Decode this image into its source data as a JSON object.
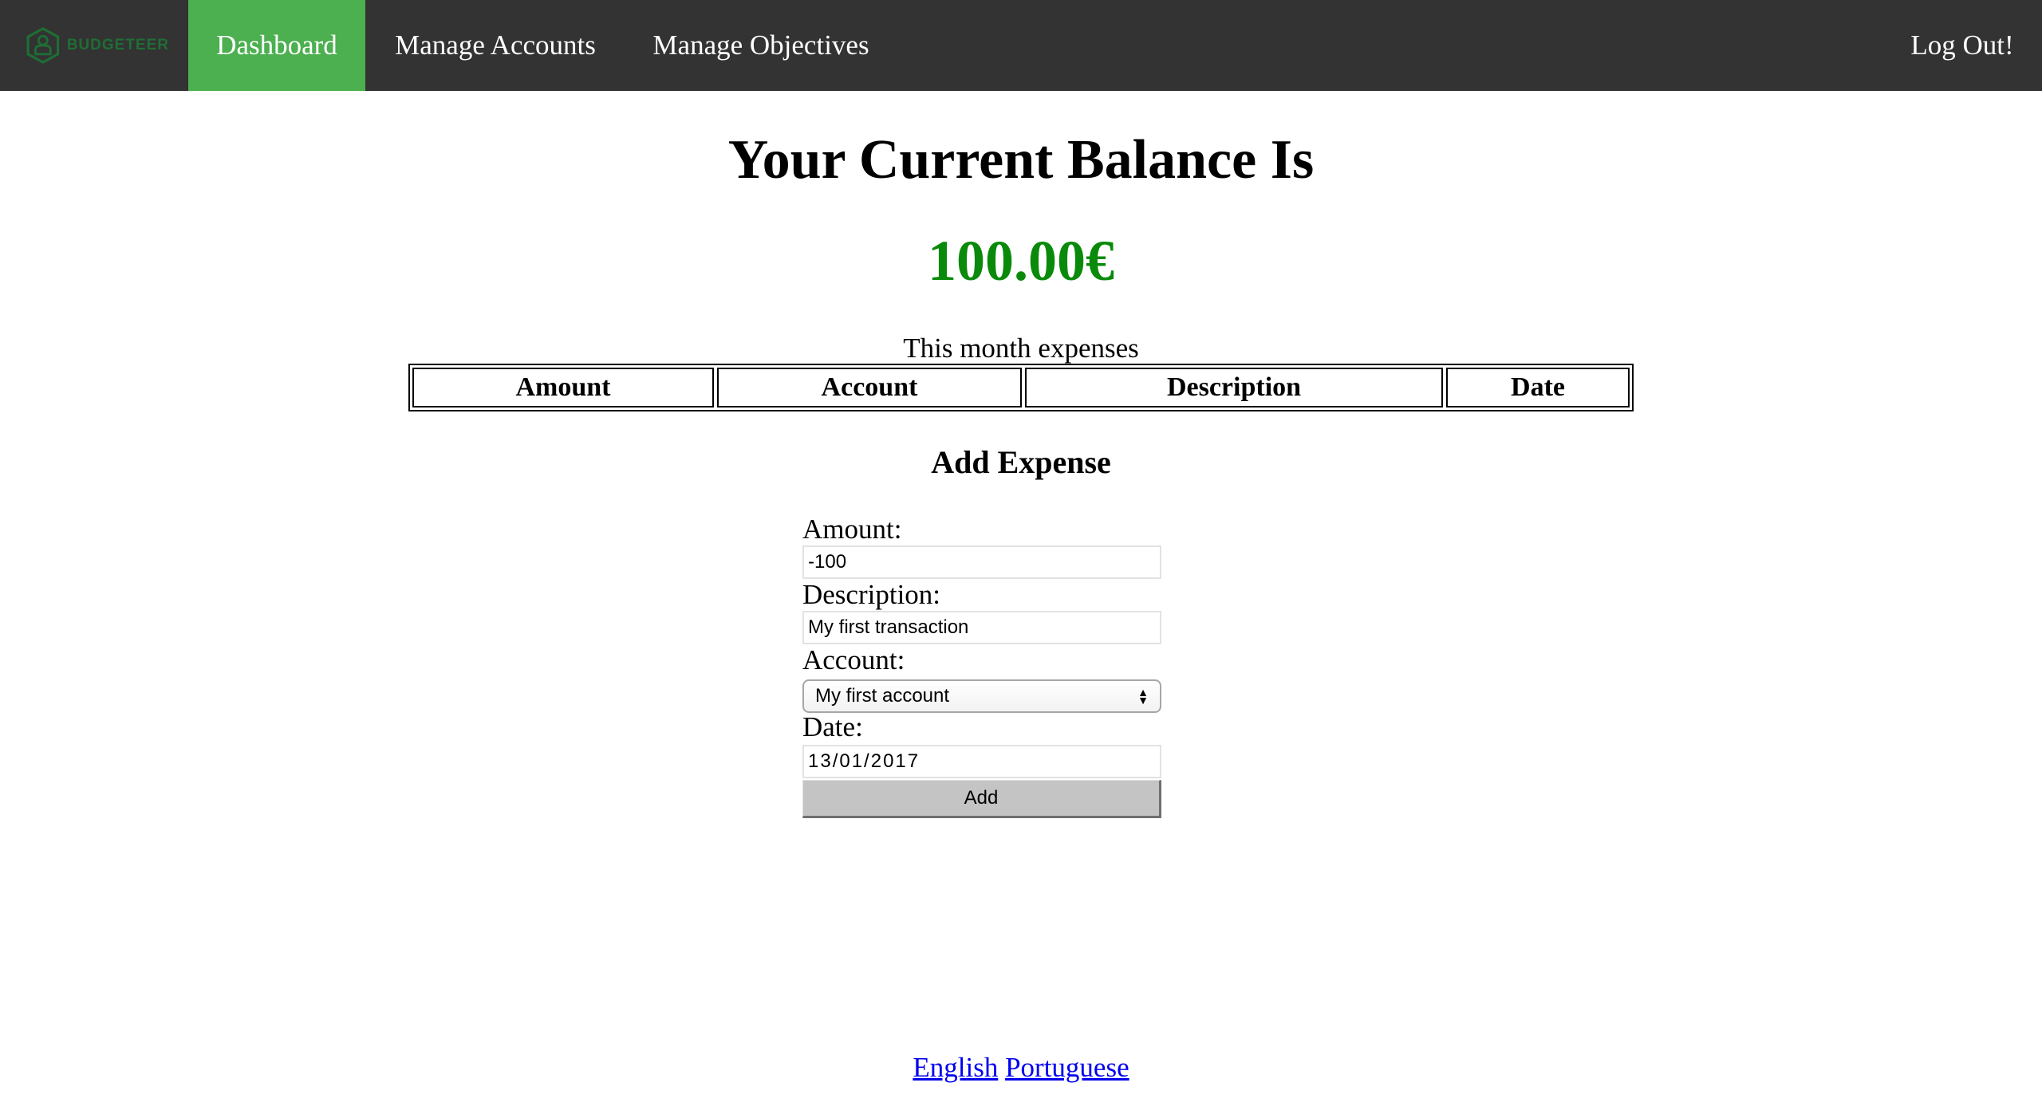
{
  "navbar": {
    "logo_text": "BUDGETEER",
    "items": [
      {
        "label": "Dashboard",
        "active": true
      },
      {
        "label": "Manage Accounts",
        "active": false
      },
      {
        "label": "Manage Objectives",
        "active": false
      }
    ],
    "logout_label": "Log Out!",
    "active_color": "#4caf50",
    "bar_color": "#333333"
  },
  "balance": {
    "title": "Your Current Balance Is",
    "value": "100.00€",
    "value_color": "#0a8a0a"
  },
  "expenses": {
    "caption": "This month expenses",
    "columns": [
      "Amount",
      "Account",
      "Description",
      "Date"
    ],
    "rows": []
  },
  "form": {
    "title": "Add Expense",
    "amount_label": "Amount:",
    "amount_value": "-100",
    "description_label": "Description:",
    "description_value": "My first transaction",
    "account_label": "Account:",
    "account_selected": "My first account",
    "date_label": "Date:",
    "date_value": "13/01/2017",
    "submit_label": "Add"
  },
  "footer": {
    "languages": [
      "English",
      "Portuguese"
    ]
  }
}
